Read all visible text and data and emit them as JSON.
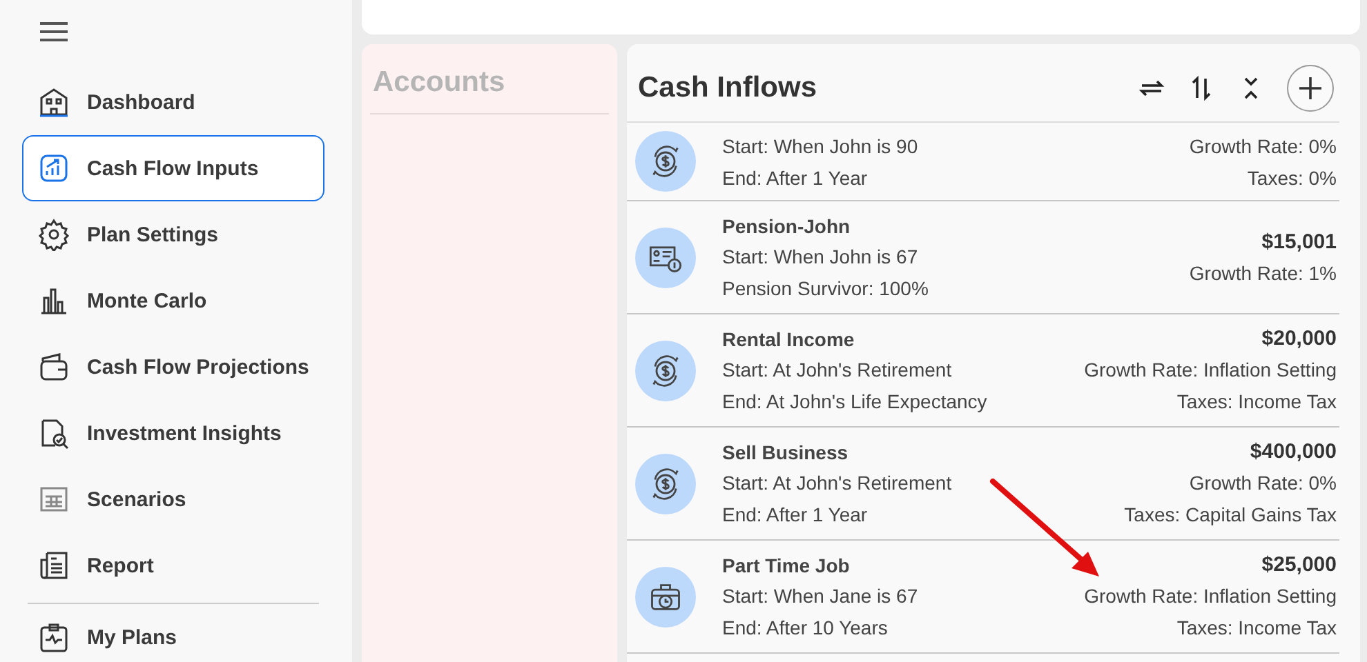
{
  "sidebar": {
    "items": [
      {
        "label": "Dashboard",
        "kind": "house",
        "selected": false
      },
      {
        "label": "Cash Flow Inputs",
        "kind": "chart",
        "selected": true
      },
      {
        "label": "Plan Settings",
        "kind": "gear",
        "selected": false
      },
      {
        "label": "Monte Carlo",
        "kind": "bars",
        "selected": false
      },
      {
        "label": "Cash Flow Projections",
        "kind": "wallet",
        "selected": false
      },
      {
        "label": "Investment Insights",
        "kind": "magnifier",
        "selected": false
      },
      {
        "label": "Scenarios",
        "kind": "grid",
        "selected": false
      },
      {
        "label": "Report",
        "kind": "doc",
        "selected": false
      }
    ],
    "footer_items": [
      {
        "label": "My Plans",
        "kind": "clipboard",
        "selected": false
      }
    ]
  },
  "accounts": {
    "title": "Accounts"
  },
  "cash_inflows": {
    "title": "Cash Inflows",
    "rows": [
      {
        "kind": "exchange",
        "details": [
          "Start: When John is 90",
          "End: After 1 Year"
        ],
        "terms": [
          "Growth Rate: 0%",
          "Taxes: 0%"
        ]
      },
      {
        "kind": "pension",
        "title": "Pension-John",
        "details": [
          "Start: When John is 67",
          "Pension Survivor: 100%"
        ],
        "amount": "$15,001",
        "terms": [
          "Growth Rate: 1%"
        ]
      },
      {
        "kind": "exchange",
        "title": "Rental Income",
        "details": [
          "Start: At John's Retirement",
          "End: At John's Life Expectancy"
        ],
        "amount": "$20,000",
        "terms": [
          "Growth Rate: Inflation Setting",
          "Taxes: Income Tax"
        ]
      },
      {
        "kind": "exchange",
        "title": "Sell Business",
        "details": [
          "Start: At John's Retirement",
          "End: After 1 Year"
        ],
        "amount": "$400,000",
        "terms": [
          "Growth Rate: 0%",
          "Taxes: Capital Gains Tax"
        ]
      },
      {
        "kind": "briefcase",
        "title": "Part Time Job",
        "details": [
          "Start: When Jane is 67",
          "End: After 10 Years"
        ],
        "amount": "$25,000",
        "terms": [
          "Growth Rate: Inflation Setting",
          "Taxes: Income Tax"
        ]
      }
    ]
  }
}
